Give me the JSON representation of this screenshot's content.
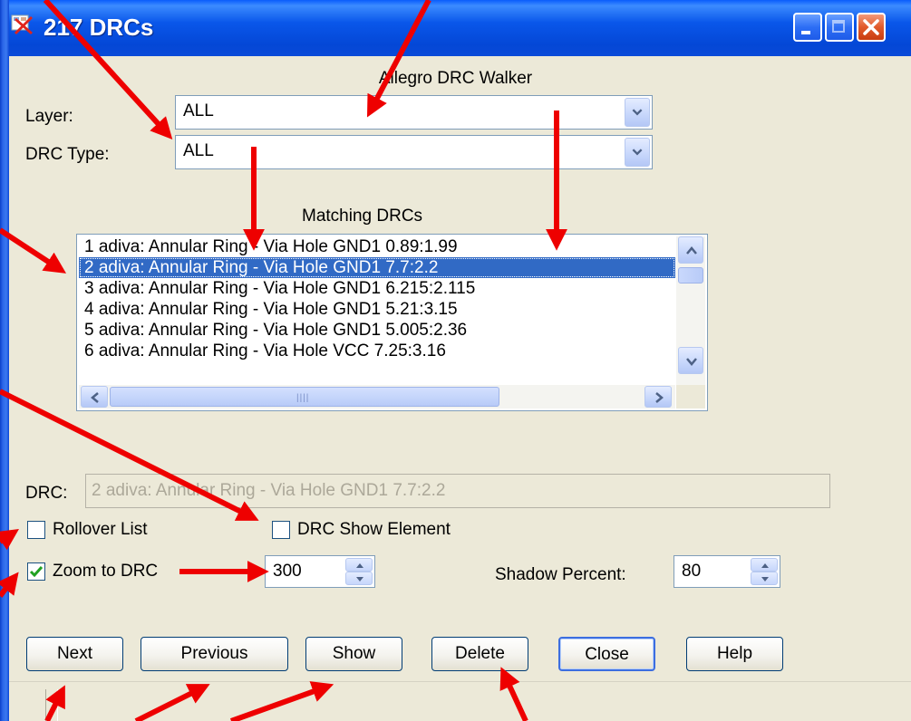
{
  "window": {
    "title": "217 DRCs"
  },
  "header": {
    "heading": "Allegro DRC Walker"
  },
  "filters": {
    "layer_label": "Layer:",
    "layer_value": "ALL",
    "drc_type_label": "DRC Type:",
    "drc_type_value": "ALL"
  },
  "list": {
    "heading": "Matching DRCs",
    "items": [
      "1 adiva:  Annular Ring - Via Hole GND1 0.89:1.99",
      "2 adiva:  Annular Ring - Via Hole GND1 7.7:2.2",
      "3 adiva:  Annular Ring - Via Hole GND1 6.215:2.115",
      "4 adiva:  Annular Ring - Via Hole GND1 5.21:3.15",
      "5 adiva:  Annular Ring - Via Hole GND1 5.005:2.36",
      "6 adiva:  Annular Ring - Via Hole VCC 7.25:3.16"
    ],
    "selected_index": 1
  },
  "drc": {
    "label": "DRC:",
    "value": "2 adiva:  Annular Ring - Via Hole GND1 7.7:2.2"
  },
  "options": {
    "rollover_label": "Rollover List",
    "rollover_checked": false,
    "show_element_label": "DRC Show Element",
    "show_element_checked": false,
    "zoom_label": "Zoom to DRC",
    "zoom_checked": true,
    "zoom_value": "300",
    "shadow_label": "Shadow Percent:",
    "shadow_value": "80"
  },
  "buttons": {
    "next": "Next",
    "previous": "Previous",
    "show": "Show",
    "delete": "Delete",
    "close": "Close",
    "help": "Help"
  },
  "colors": {
    "annotation_arrow": "#ee0000",
    "selection": "#316ac5",
    "titlebar": "#0a57ea"
  },
  "icons": {
    "app": "allegro-app-icon",
    "dropdown": "chevron-down-icon",
    "check": "checkmark-icon"
  }
}
